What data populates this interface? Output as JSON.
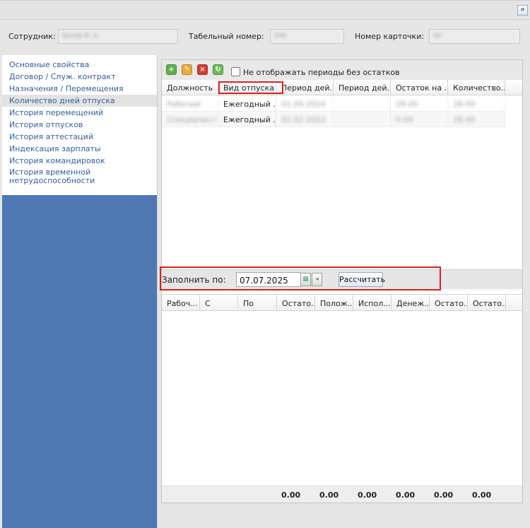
{
  "header": {
    "employee_label": "Сотрудник:",
    "employee_value": "Белов И. А.",
    "tab_number_label": "Табельный номер:",
    "tab_number_value": "000",
    "card_number_label": "Номер карточки:",
    "card_number_value": "00"
  },
  "sidebar": {
    "items": [
      {
        "label": "Основные свойства"
      },
      {
        "label": "Договор / Служ. контракт"
      },
      {
        "label": "Назначения / Перемещения"
      },
      {
        "label": "Количество дней отпуска"
      },
      {
        "label": "История перемещений"
      },
      {
        "label": "История отпусков"
      },
      {
        "label": "История аттестаций"
      },
      {
        "label": "Индексация зарплаты"
      },
      {
        "label": "История командировок"
      },
      {
        "label": "История временной нетрудоспособности"
      }
    ],
    "active_index": 3
  },
  "toolbar": {
    "hide_empty_label": "Не отображать периоды без остатков",
    "hide_empty_checked": false
  },
  "top_grid": {
    "columns": [
      "Должность",
      "Вид отпуска",
      "Период дей...",
      "Период дей...",
      "Остаток на ...",
      "Количество..."
    ],
    "rows": [
      [
        "Рабочий",
        "Ежегодный ...",
        "01.09.2024",
        "",
        "28.00",
        "28.00"
      ],
      [
        "Специалист",
        "Ежегодный ...",
        "02.02.2022",
        "",
        "0.00",
        "28.00"
      ]
    ]
  },
  "fill": {
    "label": "Заполнить по:",
    "date_value": "07.07.2025",
    "calc_button": "Рассчитать"
  },
  "bottom_grid": {
    "columns": [
      "Рабоч...",
      "С",
      "По",
      "Остато...",
      "Полож...",
      "Испол...",
      "Денеж...",
      "Остато...",
      "Остато..."
    ],
    "totals": [
      "0.00",
      "0.00",
      "0.00",
      "0.00",
      "0.00",
      "0.00"
    ]
  },
  "colors": {
    "sidebar_bg": "#4f78b2",
    "nav_link": "#2f5e9e",
    "highlight": "#e01e1e"
  }
}
